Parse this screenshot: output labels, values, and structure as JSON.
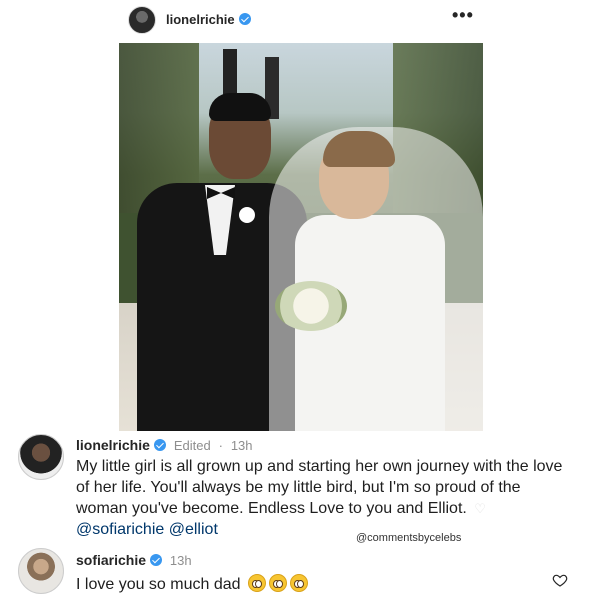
{
  "post": {
    "username": "lionelrichie",
    "more_icon": "•••"
  },
  "caption": {
    "username": "lionelrichie",
    "edited": "Edited",
    "separator": "·",
    "time": "13h",
    "text": "My little girl is all grown up and starting her own journey with the love of her life. You'll always be my little bird, but I'm so proud of the woman you've become. Endless Love to you and Elliot.",
    "heart": "♡",
    "mentions": [
      "@sofiarichie",
      "@elliot"
    ]
  },
  "watermark": "@commentsbycelebs",
  "reply": {
    "username": "sofiarichie",
    "time": "13h",
    "text": "I love you so much dad",
    "emoji_count": 3
  },
  "colors": {
    "verified": "#3897f0",
    "mention": "#00376b",
    "meta": "#8e8e8e"
  },
  "icons": [
    "verified-badge-icon",
    "more-options-icon",
    "white-heart-emoji-icon",
    "pleading-face-emoji-icon",
    "heart-outline-icon"
  ]
}
